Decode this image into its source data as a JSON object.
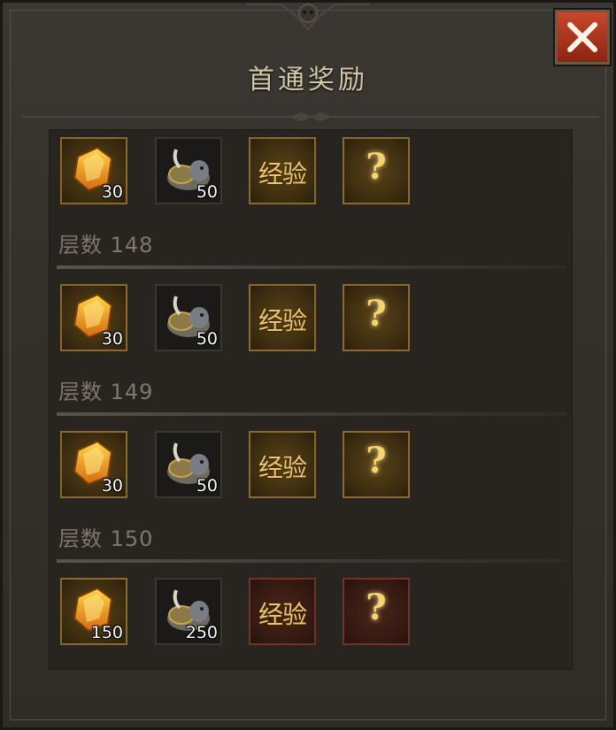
{
  "dialog": {
    "title": "首通奖励"
  },
  "rewards": [
    {
      "items": [
        {
          "icon": "amber-gem-icon",
          "qty": "30",
          "style": "gold"
        },
        {
          "icon": "rhino-mount-icon",
          "qty": "50",
          "style": "dark"
        },
        {
          "icon": "experience-icon",
          "label": "经验",
          "style": "gold"
        },
        {
          "icon": "mystery-question-icon",
          "label": "?",
          "style": "gold"
        }
      ],
      "floor_label": "层数 148"
    },
    {
      "items": [
        {
          "icon": "amber-gem-icon",
          "qty": "30",
          "style": "gold"
        },
        {
          "icon": "rhino-mount-icon",
          "qty": "50",
          "style": "dark"
        },
        {
          "icon": "experience-icon",
          "label": "经验",
          "style": "gold"
        },
        {
          "icon": "mystery-question-icon",
          "label": "?",
          "style": "gold"
        }
      ],
      "floor_label": "层数 149"
    },
    {
      "items": [
        {
          "icon": "amber-gem-icon",
          "qty": "30",
          "style": "gold"
        },
        {
          "icon": "rhino-mount-icon",
          "qty": "50",
          "style": "dark"
        },
        {
          "icon": "experience-icon",
          "label": "经验",
          "style": "gold"
        },
        {
          "icon": "mystery-question-icon",
          "label": "?",
          "style": "gold"
        }
      ],
      "floor_label": "层数 150"
    },
    {
      "items": [
        {
          "icon": "amber-gem-icon",
          "qty": "150",
          "style": "gold"
        },
        {
          "icon": "rhino-mount-icon",
          "qty": "250",
          "style": "dark"
        },
        {
          "icon": "experience-icon",
          "label": "经验",
          "style": "red"
        },
        {
          "icon": "mystery-question-icon",
          "label": "?",
          "style": "red"
        }
      ]
    }
  ],
  "colors": {
    "accent_gold": "#e8c777",
    "close_red": "#c8472a",
    "label_gray": "#7d776d"
  }
}
